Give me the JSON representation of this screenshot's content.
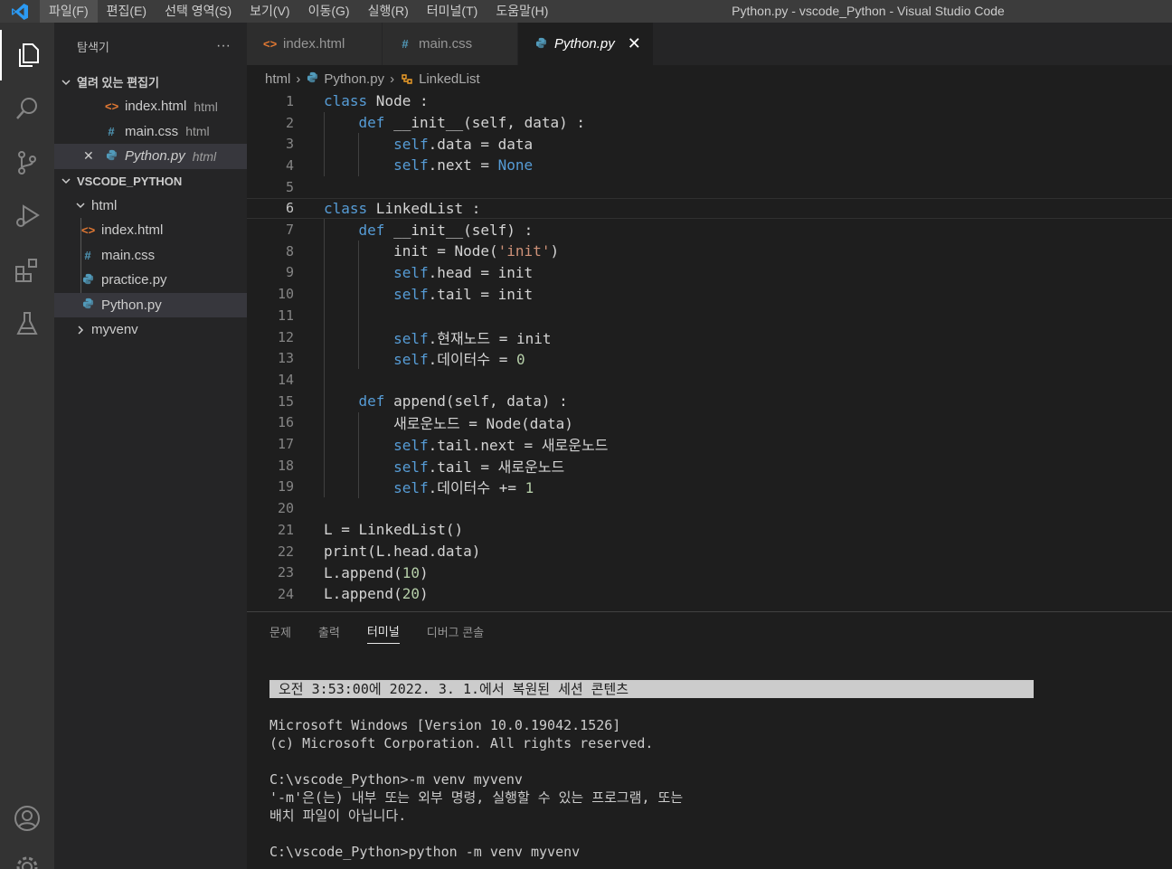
{
  "window": {
    "title": "Python.py - vscode_Python - Visual Studio Code",
    "menu": [
      "파일(F)",
      "편집(E)",
      "선택 영역(S)",
      "보기(V)",
      "이동(G)",
      "실행(R)",
      "터미널(T)",
      "도움말(H)"
    ]
  },
  "sidebar": {
    "title": "탐색기",
    "more": "···",
    "open_editors_title": "열려 있는 편집기",
    "open_editors": [
      {
        "name": "index.html",
        "desc": "html",
        "icon": "<>"
      },
      {
        "name": "main.css",
        "desc": "html",
        "icon": "#"
      },
      {
        "name": "Python.py",
        "desc": "html",
        "icon": "py",
        "close": "✕"
      }
    ],
    "workspace_title": "VSCODE_PYTHON",
    "tree": {
      "folder": "html",
      "files": [
        {
          "name": "index.html",
          "icon": "<>"
        },
        {
          "name": "main.css",
          "icon": "#"
        },
        {
          "name": "practice.py",
          "icon": "py"
        },
        {
          "name": "Python.py",
          "icon": "py"
        }
      ],
      "venv": "myvenv"
    }
  },
  "tabs": [
    {
      "label": "index.html",
      "icon": "<>"
    },
    {
      "label": "main.css",
      "icon": "#"
    },
    {
      "label": "Python.py",
      "icon": "py",
      "close": "✕"
    }
  ],
  "breadcrumb": {
    "root": "html",
    "file": "Python.py",
    "symbol": "LinkedList",
    "sep": "›"
  },
  "editor": {
    "current_line": 6,
    "lines": [
      {
        "n": "1",
        "html": "<span class=\"kw\">class</span> Node :"
      },
      {
        "n": "2",
        "html": "    <span class=\"kw\">def</span> __init__(self, data) :"
      },
      {
        "n": "3",
        "html": "        <span class=\"kw\">self</span>.data = data"
      },
      {
        "n": "4",
        "html": "        <span class=\"kw\">self</span>.next = <span class=\"kw\">None</span>"
      },
      {
        "n": "5",
        "html": ""
      },
      {
        "n": "6",
        "html": "<span class=\"kw\">class</span> LinkedList :"
      },
      {
        "n": "7",
        "html": "    <span class=\"kw\">def</span> __init__(self) :"
      },
      {
        "n": "8",
        "html": "        init = Node(<span class=\"str\">'init'</span>)"
      },
      {
        "n": "9",
        "html": "        <span class=\"kw\">self</span>.head = init"
      },
      {
        "n": "10",
        "html": "        <span class=\"kw\">self</span>.tail = init"
      },
      {
        "n": "11",
        "html": ""
      },
      {
        "n": "12",
        "html": "        <span class=\"kw\">self</span>.현재노드 = init"
      },
      {
        "n": "13",
        "html": "        <span class=\"kw\">self</span>.데이터수 = <span class=\"num\">0</span>"
      },
      {
        "n": "14",
        "html": ""
      },
      {
        "n": "15",
        "html": "    <span class=\"kw\">def</span> append(self, data) :"
      },
      {
        "n": "16",
        "html": "        새로운노드 = Node(data)"
      },
      {
        "n": "17",
        "html": "        <span class=\"kw\">self</span>.tail.next = 새로운노드"
      },
      {
        "n": "18",
        "html": "        <span class=\"kw\">self</span>.tail = 새로운노드"
      },
      {
        "n": "19",
        "html": "        <span class=\"kw\">self</span>.데이터수 += <span class=\"num\">1</span>"
      },
      {
        "n": "20",
        "html": ""
      },
      {
        "n": "21",
        "html": "L = LinkedList()"
      },
      {
        "n": "22",
        "html": "print(L.head.data)"
      },
      {
        "n": "23",
        "html": "L.append(<span class=\"num\">10</span>)"
      },
      {
        "n": "24",
        "html": "L.append(<span class=\"num\">20</span>)"
      }
    ]
  },
  "panel": {
    "tabs": [
      "문제",
      "출력",
      "터미널",
      "디버그 콘솔"
    ],
    "active_tab": 2,
    "terminal": {
      "banner": "오전 3:53:00에 2022. 3. 1.에서 복원된 세션 콘텐츠",
      "lines": [
        "",
        "Microsoft Windows [Version 10.0.19042.1526]",
        "(c) Microsoft Corporation. All rights reserved.",
        "",
        "C:\\vscode_Python>-m venv myvenv",
        "'-m'은(는) 내부 또는 외부 명령, 실행할 수 있는 프로그램, 또는",
        "배치 파일이 아닙니다.",
        "",
        "C:\\vscode_Python>python -m venv myvenv"
      ]
    }
  },
  "colors": {
    "keyword": "#569cd6",
    "string": "#ce9178",
    "number": "#b5cea8",
    "vscode_blue": "#0078d4"
  }
}
